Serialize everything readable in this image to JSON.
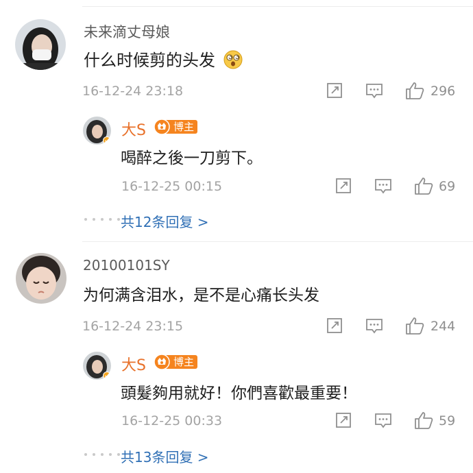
{
  "comments": [
    {
      "user": "未来滴丈母娘",
      "text": "什么时候剪的头发",
      "emoji_icon": "dizzy-face-emoji",
      "time": "16-12-24 23:18",
      "likes": "296",
      "reply": {
        "user": "大S",
        "badge": "博主",
        "text": "喝醉之後一刀剪下。",
        "time": "16-12-25 00:15",
        "likes": "69"
      },
      "more_label": "共12条回复 >"
    },
    {
      "user": "20100101SY",
      "text": "为何满含泪水，是不是心痛长头发",
      "time": "16-12-24 23:15",
      "likes": "244",
      "reply": {
        "user": "大S",
        "badge": "博主",
        "text": "頭髮夠用就好！你們喜歡最重要！",
        "time": "16-12-25 00:33",
        "likes": "59"
      },
      "more_label": "共13条回复 >"
    }
  ],
  "colors": {
    "reply_name": "#e8712a",
    "badge": "#f5841f",
    "link": "#2f6fb5",
    "meta": "#a3a3a3"
  }
}
